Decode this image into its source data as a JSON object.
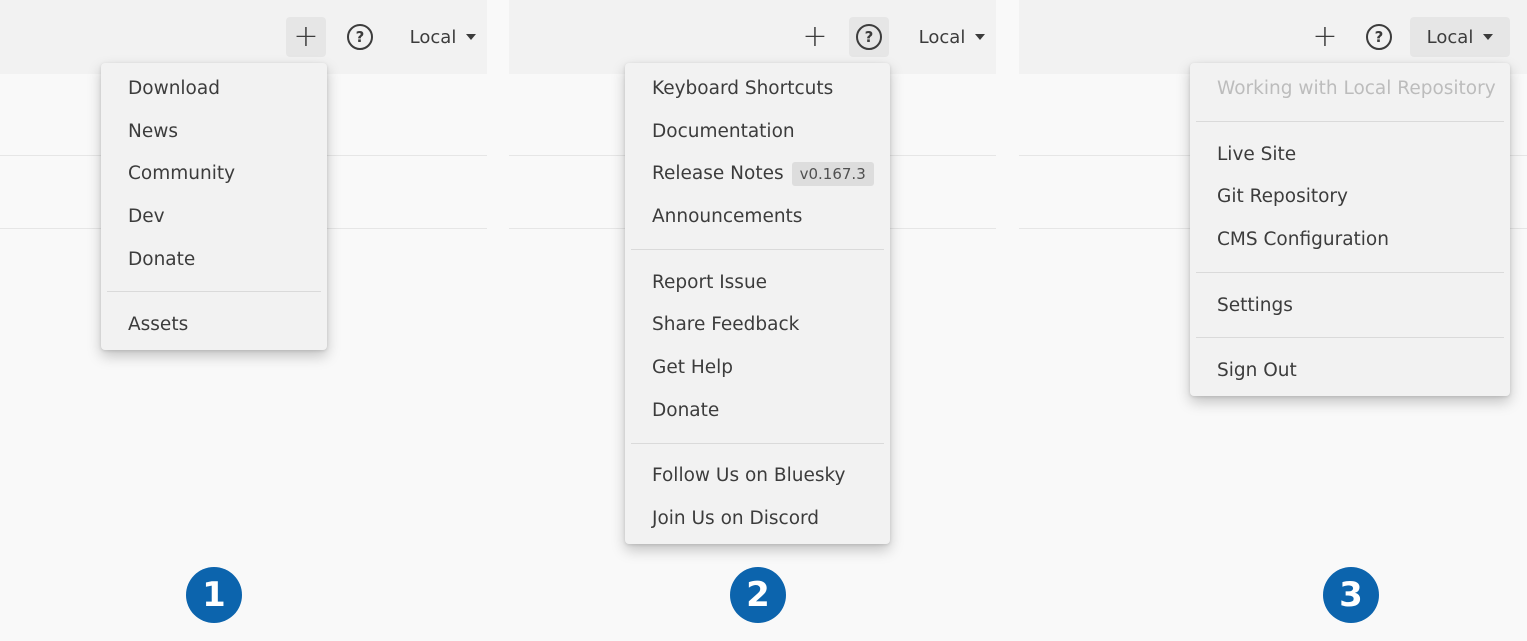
{
  "toolbar": {
    "add_label": "+",
    "help_label": "?",
    "local_label": "Local"
  },
  "panel1": {
    "menu_items": [
      "Download",
      "News",
      "Community",
      "Dev",
      "Donate"
    ],
    "menu_items_b": [
      "Assets"
    ],
    "number": "1"
  },
  "panel2": {
    "group1": [
      "Keyboard Shortcuts",
      "Documentation"
    ],
    "release_notes": {
      "label": "Release Notes",
      "version": "v0.167.3"
    },
    "announcements": "Announcements",
    "group2": [
      "Report Issue",
      "Share Feedback",
      "Get Help",
      "Donate"
    ],
    "group3": [
      "Follow Us on Bluesky",
      "Join Us on Discord"
    ],
    "number": "2"
  },
  "panel3": {
    "header": "Working with Local Repository",
    "group1": [
      "Live Site",
      "Git Repository",
      "CMS Configuration"
    ],
    "settings": "Settings",
    "sign_out": "Sign Out",
    "number": "3"
  },
  "colors": {
    "badge": "#0c64ad",
    "active_bg": "#e6e6e6",
    "menu_bg": "#f2f2f2"
  }
}
